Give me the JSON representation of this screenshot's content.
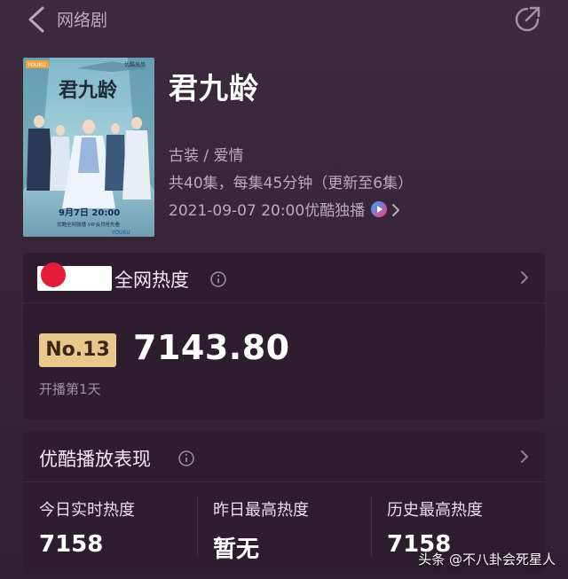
{
  "header": {
    "title": "网络剧"
  },
  "show": {
    "title": "君九龄",
    "genre": "古装 / 爱情",
    "episodes": "共40集，每集45分钟（更新至6集）",
    "premiere": "2021-09-07 20:00优酷独播"
  },
  "poster": {
    "top_left_badge": "YOUKU",
    "top_right_badge": "优酷出品",
    "title_calligraphy": "君九龄",
    "date": "9月7日 20:00",
    "caption": "优酷全网独播  VIP会员抢先看",
    "bottom_logo": "YOUKU"
  },
  "heat_card": {
    "title_visible": "全网热度",
    "rank": "No.13",
    "score": "7143.80",
    "since": "开播第1天"
  },
  "youku_card": {
    "title": "优酷播放表现",
    "stats": [
      {
        "label": "今日实时热度",
        "value": "7158"
      },
      {
        "label": "昨日最高热度",
        "value": "暂无"
      },
      {
        "label": "历史最高热度",
        "value": "7158"
      }
    ]
  },
  "watermark": "头条 @不八卦会死星人",
  "colors": {
    "background": "#3d2a3c",
    "card": "#2d1d2e",
    "rank_badge": "#e9c88d"
  }
}
